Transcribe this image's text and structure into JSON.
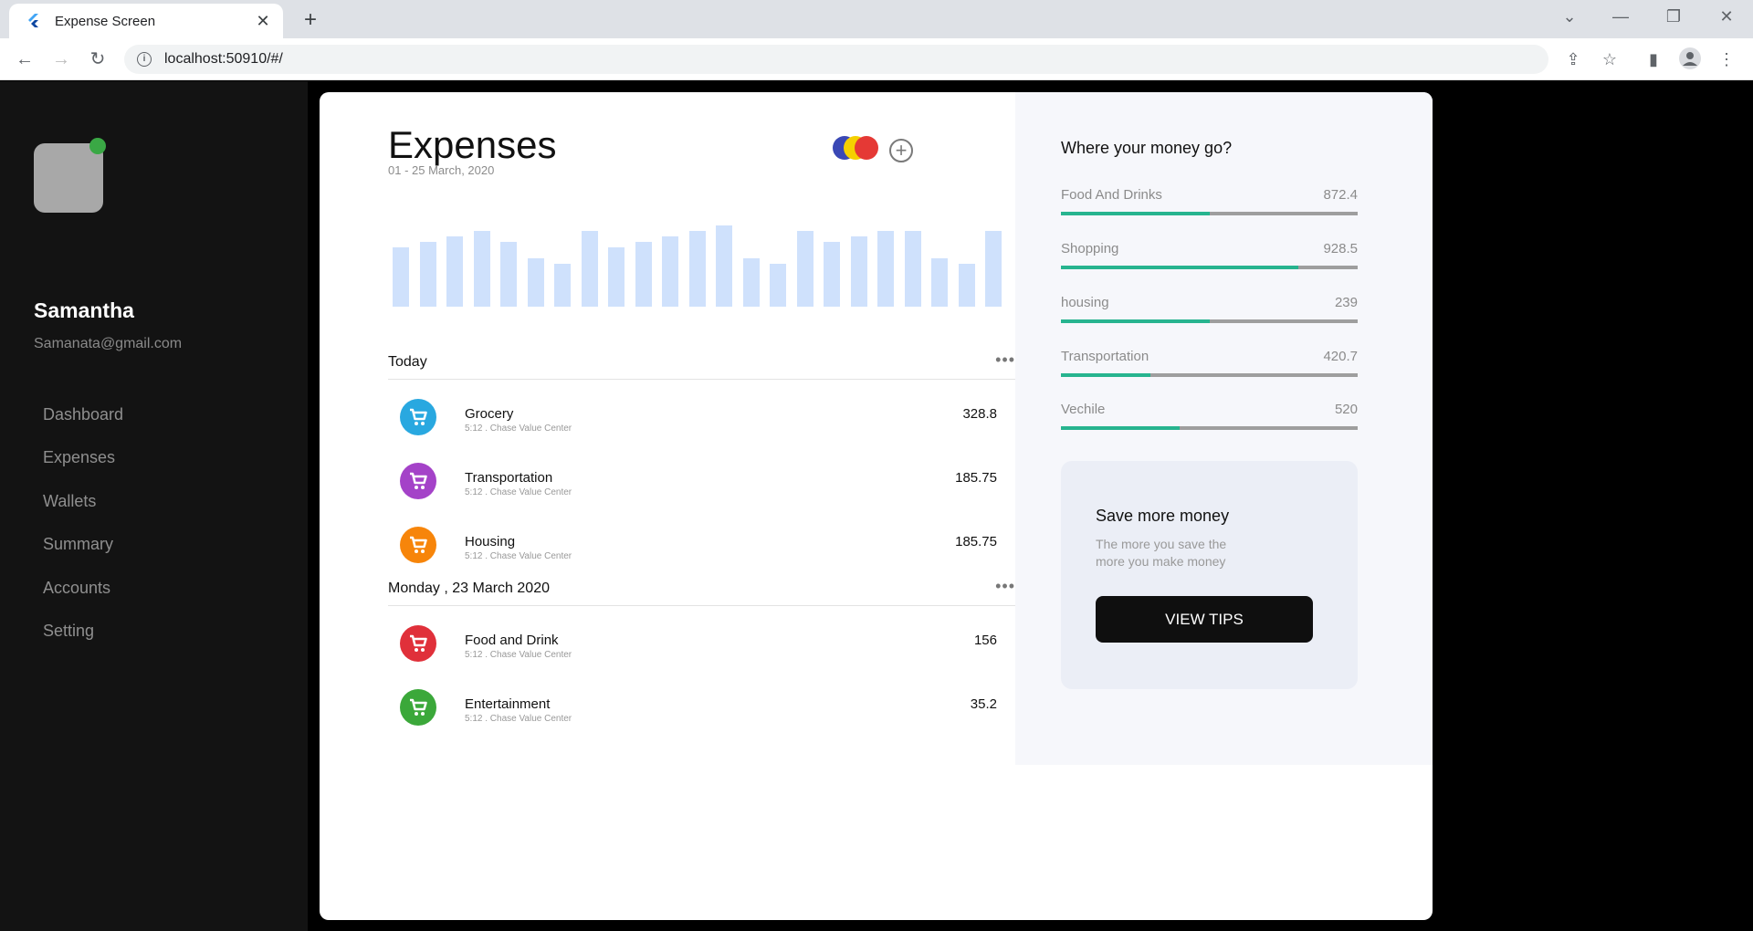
{
  "browser": {
    "tab_title": "Expense Screen",
    "url": "localhost:50910/#/"
  },
  "sidebar": {
    "user_name": "Samantha",
    "user_email": "Samanata@gmail.com",
    "items": [
      {
        "label": "Dashboard"
      },
      {
        "label": "Expenses"
      },
      {
        "label": "Wallets"
      },
      {
        "label": "Summary"
      },
      {
        "label": "Accounts"
      },
      {
        "label": "Setting"
      }
    ],
    "status_color": "#3aa845"
  },
  "main": {
    "title": "Expenses",
    "date_range": "01 - 25 March, 2020",
    "legend_colors": [
      "#3a48b5",
      "#f5d000",
      "#e53935"
    ],
    "chart_data": {
      "type": "bar",
      "values": [
        55,
        60,
        65,
        70,
        60,
        45,
        40,
        70,
        55,
        60,
        65,
        70,
        75,
        45,
        40,
        70,
        60,
        65,
        70,
        70,
        45,
        40,
        70
      ],
      "color": "#cfe1fc"
    },
    "sections": [
      {
        "label": "Today",
        "transactions": [
          {
            "name": "Grocery",
            "sub": "5:12 . Chase Value Center",
            "amount": "328.8",
            "color": "#29a8e0"
          },
          {
            "name": "Transportation",
            "sub": "5:12 . Chase Value Center",
            "amount": "185.75",
            "color": "#a442c8"
          },
          {
            "name": "Housing",
            "sub": "5:12 . Chase Value Center",
            "amount": "185.75",
            "color": "#f7850a"
          }
        ]
      },
      {
        "label": "Monday , 23 March 2020",
        "transactions": [
          {
            "name": "Food and Drink",
            "sub": "5:12 . Chase Value Center",
            "amount": "156",
            "color": "#e0303a"
          },
          {
            "name": "Entertainment",
            "sub": "5:12 . Chase Value Center",
            "amount": "35.2",
            "color": "#3ba83a"
          }
        ]
      }
    ]
  },
  "right_panel": {
    "title": "Where your money go?",
    "categories": [
      {
        "label": "Food And Drinks",
        "value": "872.4",
        "fraction": 0.5
      },
      {
        "label": "Shopping",
        "value": "928.5",
        "fraction": 0.8
      },
      {
        "label": "housing",
        "value": "239",
        "fraction": 0.5
      },
      {
        "label": "Transportation",
        "value": "420.7",
        "fraction": 0.3
      },
      {
        "label": "Vechile",
        "value": "520",
        "fraction": 0.4
      }
    ],
    "tip_card": {
      "title": "Save more money",
      "text": "The more you save the more you make  money",
      "button": "VIEW TIPS"
    }
  }
}
